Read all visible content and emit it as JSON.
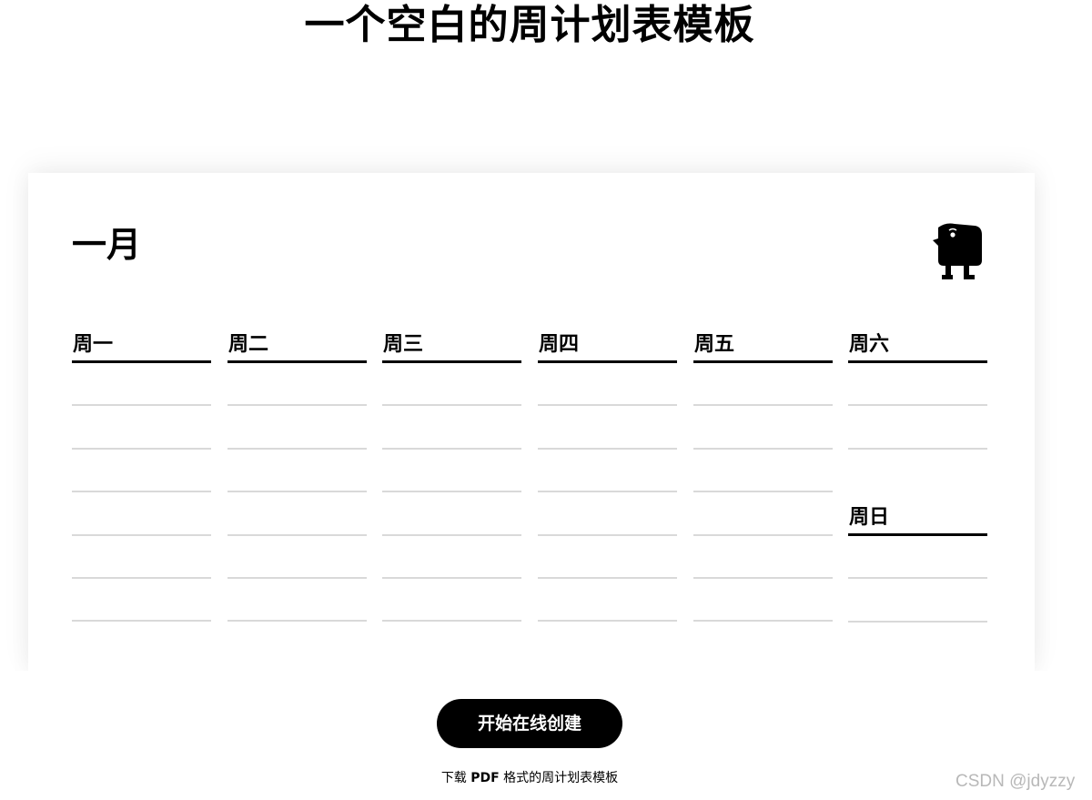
{
  "page": {
    "title": "一个空白的周计划表模板"
  },
  "planner": {
    "month": "一月",
    "mascot_icon": "bird-mascot-icon",
    "days": [
      {
        "label": "周一",
        "lines": 6
      },
      {
        "label": "周二",
        "lines": 6
      },
      {
        "label": "周三",
        "lines": 6
      },
      {
        "label": "周四",
        "lines": 6
      },
      {
        "label": "周五",
        "lines": 6
      },
      {
        "label": "周六",
        "lines": 2
      }
    ],
    "sunday": {
      "label": "周日",
      "lines": 2
    }
  },
  "cta": {
    "label": "开始在线创建"
  },
  "download": {
    "prefix": "下载 ",
    "format": "PDF",
    "suffix": " 格式的周计划表模板"
  },
  "watermark": {
    "text": "CSDN @jdyzzy"
  },
  "colors": {
    "accent": "#000000",
    "line": "#d9d9d9",
    "background": "#ffffff"
  }
}
